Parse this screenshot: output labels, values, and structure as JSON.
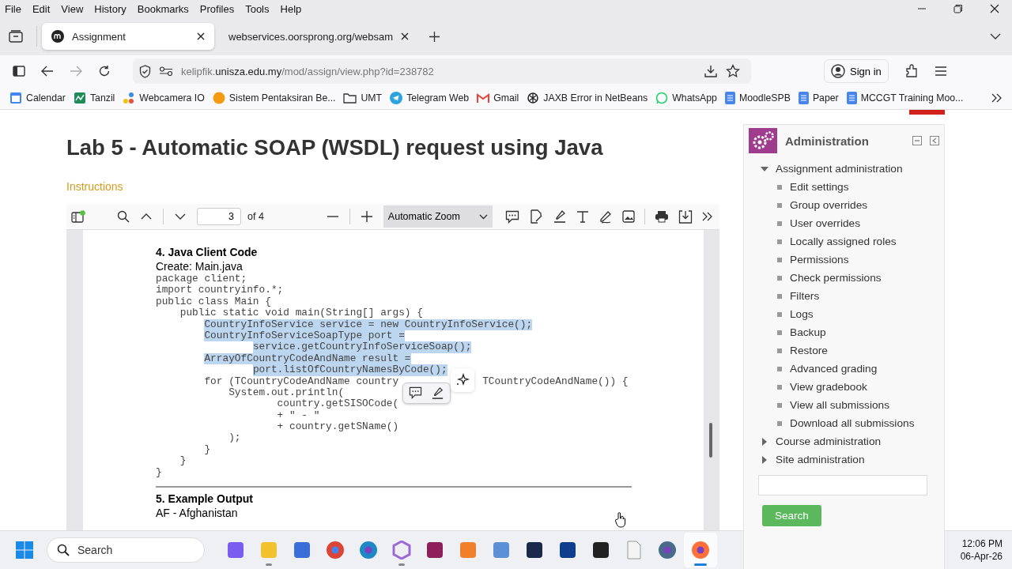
{
  "menu": [
    "File",
    "Edit",
    "View",
    "History",
    "Bookmarks",
    "Profiles",
    "Tools",
    "Help"
  ],
  "tabs": [
    {
      "label": "Assignment",
      "selected": true
    },
    {
      "label": "webservices.oorsprong.org/websam",
      "selected": false
    }
  ],
  "address": {
    "prefix": "kelipfik.",
    "domain": "unisza.edu.my",
    "path": "/mod/assign/view.php?id=238782"
  },
  "sign_in": "Sign in",
  "bookmarks": [
    "Calendar",
    "Tanzil",
    "Webcamera IO",
    "Sistem Pentaksiran Be...",
    "UMT",
    "Telegram Web",
    "Gmail",
    "JAXB Error in NetBeans",
    "WhatsApp",
    "MoodleSPB",
    "Paper",
    "MCCGT Training Moo..."
  ],
  "page": {
    "title": "Lab 5 - Automatic SOAP (WSDL) request using Java",
    "link": "Instructions"
  },
  "viewer": {
    "page_number": "3",
    "page_count": "of 4",
    "zoom": "Automatic Zoom"
  },
  "document": {
    "heading": "4. Java Client Code",
    "subheading": "Create: Main.java",
    "code": [
      {
        "text": "package client;",
        "highlighted": false
      },
      {
        "text": "import countryinfo.*;",
        "highlighted": false
      },
      {
        "text": "public class Main {",
        "highlighted": false
      },
      {
        "text": "    public static void main(String[] args) {",
        "highlighted": false
      },
      {
        "text": "        CountryInfoService service = new CountryInfoService();",
        "highlighted": true
      },
      {
        "text": "        CountryInfoServiceSoapType port =",
        "highlighted": true
      },
      {
        "text": "                service.getCountryInfoServiceSoap();",
        "highlighted": true
      },
      {
        "text": "        ArrayOfCountryCodeAndName result =",
        "highlighted": true
      },
      {
        "text": "                port.listOfCountryNamesByCode();",
        "highlighted": true
      },
      {
        "text": "        for (TCountryCodeAndName country",
        "tail": "TCountryCodeAndName()) {",
        "highlighted": false
      },
      {
        "text": "            System.out.println(",
        "highlighted": false
      },
      {
        "text": "                    country.getSISOCode(",
        "highlighted": false
      },
      {
        "text": "                    + \" - \"",
        "highlighted": false
      },
      {
        "text": "                    + country.getSName()",
        "highlighted": false
      },
      {
        "text": "            );",
        "highlighted": false
      },
      {
        "text": "        }",
        "highlighted": false
      },
      {
        "text": "    }",
        "highlighted": false
      },
      {
        "text": "}",
        "highlighted": false
      }
    ],
    "heading2": "5. Example Output",
    "output": "AF - Afghanistan"
  },
  "admin": {
    "title": "Administration",
    "tree": [
      {
        "label": "Assignment administration",
        "expanded": true,
        "children": [
          {
            "label": "Edit settings"
          },
          {
            "label": "Group overrides"
          },
          {
            "label": "User overrides"
          },
          {
            "label": "Locally assigned roles"
          },
          {
            "label": "Permissions"
          },
          {
            "label": "Check permissions"
          },
          {
            "label": "Filters"
          },
          {
            "label": "Logs"
          },
          {
            "label": "Backup"
          },
          {
            "label": "Restore"
          },
          {
            "label": "Advanced grading"
          },
          {
            "label": "View gradebook"
          },
          {
            "label": "View all submissions"
          },
          {
            "label": "Download all submissions"
          }
        ]
      },
      {
        "label": "Course administration",
        "expanded": false
      },
      {
        "label": "Site administration",
        "expanded": false
      }
    ],
    "search_button": "Search"
  },
  "taskbar": {
    "search_placeholder": "Search",
    "apps": [
      {
        "running": false,
        "selected": false
      },
      {
        "running": true,
        "selected": false
      },
      {
        "running": false,
        "selected": false
      },
      {
        "running": false,
        "selected": false
      },
      {
        "running": false,
        "selected": false
      },
      {
        "running": true,
        "selected": false
      },
      {
        "running": false,
        "selected": false
      },
      {
        "running": false,
        "selected": false
      },
      {
        "running": false,
        "selected": false
      },
      {
        "running": false,
        "selected": false
      },
      {
        "running": false,
        "selected": false
      },
      {
        "running": false,
        "selected": false
      },
      {
        "running": false,
        "selected": false
      },
      {
        "running": false,
        "selected": false
      },
      {
        "running": true,
        "selected": true
      }
    ],
    "time": "12:06 PM",
    "date": "06-Apr-26"
  }
}
